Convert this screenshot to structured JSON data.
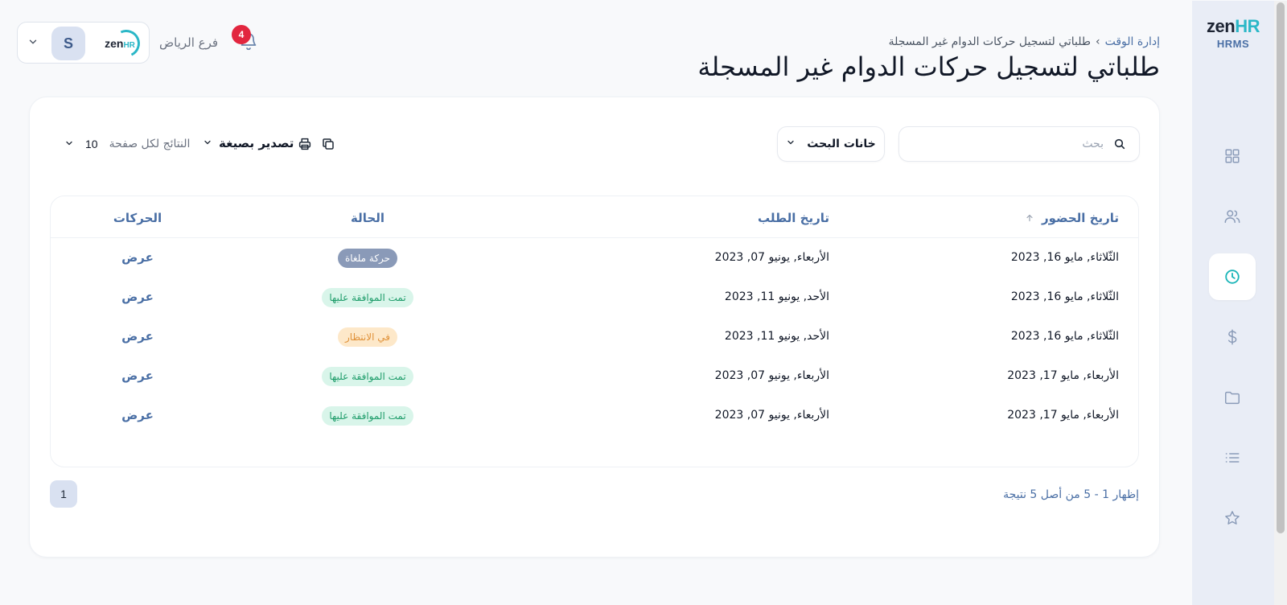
{
  "brand": {
    "logo_main": "zen",
    "logo_accent": "HR",
    "logo_sub": "HRMS",
    "accent_color": "#1bb5b8"
  },
  "sidebar": {
    "items": [
      {
        "icon": "grid-icon"
      },
      {
        "icon": "users-icon"
      },
      {
        "icon": "clock-icon",
        "active": true
      },
      {
        "icon": "dollar-icon"
      },
      {
        "icon": "folder-icon"
      },
      {
        "icon": "list-icon"
      },
      {
        "icon": "star-icon"
      }
    ]
  },
  "header": {
    "breadcrumb_parent": "إدارة الوقت",
    "breadcrumb_current": "طلباتي لتسجيل حركات الدوام غير المسجلة",
    "title": "طلباتي لتسجيل حركات الدوام غير المسجلة",
    "branch": "فرع الرياض",
    "notifications_count": "4",
    "avatar_initial": "S",
    "company_logo_main": "zen",
    "company_logo_accent": "HR"
  },
  "toolbar": {
    "search_placeholder": "بحث",
    "search_fields_label": "خانات البحث",
    "export_label": "تصدير بصيغة",
    "per_page_label": "النتائج لكل صفحة",
    "per_page_value": "10"
  },
  "table": {
    "columns": {
      "attendance_date": "تاريخ الحضور",
      "request_date": "تاريخ الطلب",
      "status": "الحالة",
      "actions": "الحركات"
    },
    "rows": [
      {
        "attendance_date": "الثّلاثاء, مايو 16, 2023",
        "request_date": "الأربعاء, يونيو 07, 2023",
        "status": "حركة ملغاة",
        "status_type": "cancelled",
        "action": "عرض"
      },
      {
        "attendance_date": "الثّلاثاء, مايو 16, 2023",
        "request_date": "الأحد, يونيو 11, 2023",
        "status": "تمت الموافقة عليها",
        "status_type": "approved",
        "action": "عرض"
      },
      {
        "attendance_date": "الثّلاثاء, مايو 16, 2023",
        "request_date": "الأحد, يونيو 11, 2023",
        "status": "في الانتظار",
        "status_type": "pending",
        "action": "عرض"
      },
      {
        "attendance_date": "الأربعاء, مايو 17, 2023",
        "request_date": "الأربعاء, يونيو 07, 2023",
        "status": "تمت الموافقة عليها",
        "status_type": "approved",
        "action": "عرض"
      },
      {
        "attendance_date": "الأربعاء, مايو 17, 2023",
        "request_date": "الأربعاء, يونيو 07, 2023",
        "status": "تمت الموافقة عليها",
        "status_type": "approved",
        "action": "عرض"
      }
    ]
  },
  "status_colors": {
    "cancelled": {
      "bg": "#8a9ab8",
      "fg": "#ffffff"
    },
    "approved": {
      "bg": "#d9f5ea",
      "fg": "#1f9d6b"
    },
    "pending": {
      "bg": "#fde8c9",
      "fg": "#e0923a"
    }
  },
  "pagination": {
    "summary": "إظهار 1 - 5 من أصل 5 نتيجة",
    "current_page": "1"
  }
}
